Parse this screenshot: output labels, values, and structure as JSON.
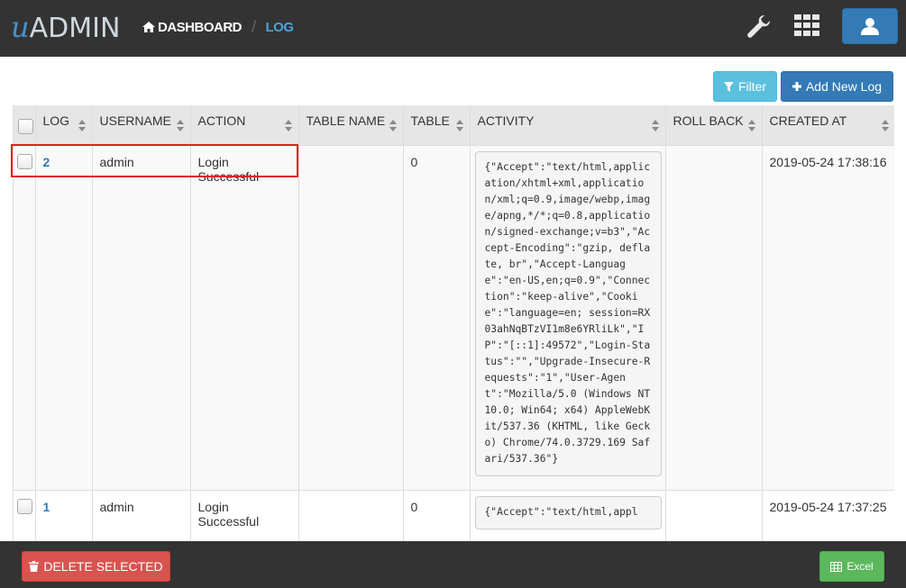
{
  "app": {
    "logo_u": "u",
    "logo_rest": "ADMIN"
  },
  "breadcrumb": {
    "home": "DASHBOARD",
    "separator": "/",
    "current": "LOG"
  },
  "toolbar": {
    "filter_label": "Filter",
    "add_label": "Add New Log"
  },
  "table": {
    "columns": [
      "LOG",
      "USERNAME",
      "ACTION",
      "TABLE NAME",
      "TABLE",
      "ACTIVITY",
      "ROLL BACK",
      "CREATED AT"
    ],
    "rows": [
      {
        "log": "2",
        "username": "admin",
        "action": "Login Successful",
        "table_name": "",
        "table": "0",
        "activity": "{\"Accept\":\"text/html,application/xhtml+xml,application/xml;q=0.9,image/webp,image/apng,*/*;q=0.8,application/signed-exchange;v=b3\",\"Accept-Encoding\":\"gzip, deflate, br\",\"Accept-Language\":\"en-US,en;q=0.9\",\"Connection\":\"keep-alive\",\"Cookie\":\"language=en; session=RX03ahNqBTzVI1m8e6YRliLk\",\"IP\":\"[::1]:49572\",\"Login-Status\":\"\",\"Upgrade-Insecure-Requests\":\"1\",\"User-Agent\":\"Mozilla/5.0 (Windows NT 10.0; Win64; x64) AppleWebKit/537.36 (KHTML, like Gecko) Chrome/74.0.3729.169 Safari/537.36\"}",
        "roll_back": "",
        "created_at": "2019-05-24 17:38:16"
      },
      {
        "log": "1",
        "username": "admin",
        "action": "Login Successful",
        "table_name": "",
        "table": "0",
        "activity": "{\"Accept\":\"text/html,appl",
        "roll_back": "",
        "created_at": "2019-05-24 17:37:25"
      }
    ]
  },
  "footer": {
    "delete_label": "DELETE SELECTED",
    "excel_label": "Excel"
  },
  "colors": {
    "topbar": "#333333",
    "primary": "#337ab7",
    "info": "#5bc0de",
    "danger": "#d9534f",
    "success": "#5cb85c",
    "highlight": "#e02020"
  },
  "icons": [
    "home-icon",
    "wrench-icon",
    "apps-grid-icon",
    "user-icon",
    "filter-icon",
    "plus-icon",
    "sort-icon",
    "trash-icon",
    "table-icon"
  ]
}
